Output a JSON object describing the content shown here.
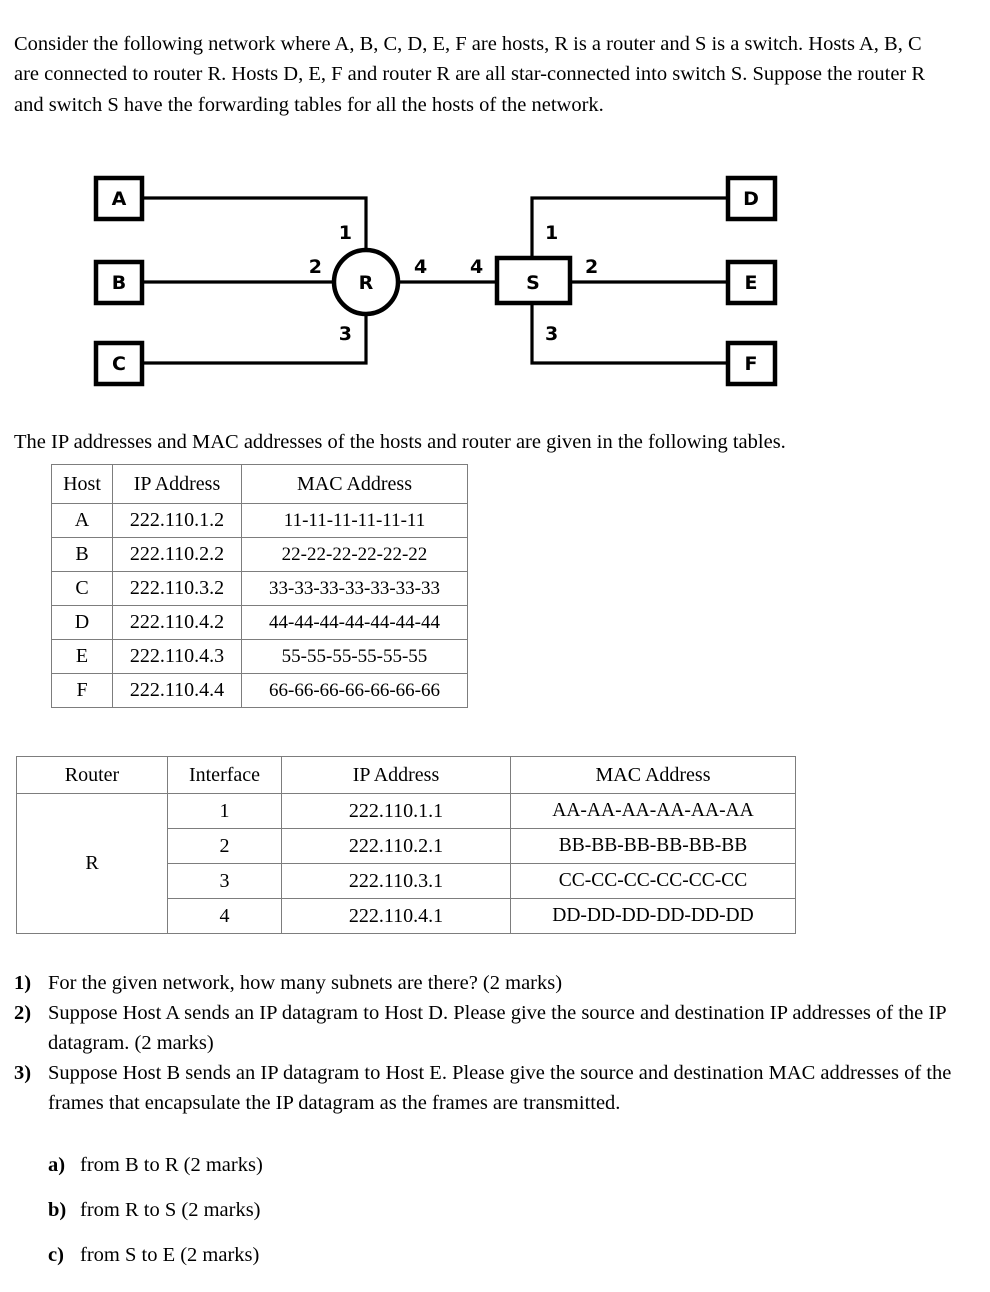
{
  "intro": {
    "paragraph": "Consider the following network where A, B, C, D, E, F are hosts, R is a router and S is a switch. Hosts A, B, C are connected to router R. Hosts D, E, F and router R are all star-connected into switch S. Suppose the router R and switch S have the forwarding tables for all the hosts of the network."
  },
  "diagram": {
    "hosts_left": [
      "A",
      "B",
      "C"
    ],
    "hosts_right": [
      "D",
      "E",
      "F"
    ],
    "router": "R",
    "switch": "S",
    "router_ports": {
      "to_A": "1",
      "to_B": "2",
      "to_C": "3",
      "to_S": "4"
    },
    "switch_ports": {
      "to_R": "4",
      "to_D": "1",
      "to_E": "2",
      "to_F": "3"
    }
  },
  "mid_sentence": "The IP addresses and MAC addresses of the hosts and router are given in the following tables.",
  "host_table": {
    "headers": [
      "Host",
      "IP Address",
      "MAC Address"
    ],
    "rows": [
      [
        "A",
        "222.110.1.2",
        "11-11-11-11-11-11"
      ],
      [
        "B",
        "222.110.2.2",
        "22-22-22-22-22-22"
      ],
      [
        "C",
        "222.110.3.2",
        "33-33-33-33-33-33-33"
      ],
      [
        "D",
        "222.110.4.2",
        "44-44-44-44-44-44-44"
      ],
      [
        "E",
        "222.110.4.3",
        "55-55-55-55-55-55"
      ],
      [
        "F",
        "222.110.4.4",
        "66-66-66-66-66-66-66"
      ]
    ]
  },
  "router_table": {
    "headers": [
      "Router",
      "Interface",
      "IP Address",
      "MAC Address"
    ],
    "router_name": "R",
    "rows": [
      [
        "1",
        "222.110.1.1",
        "AA-AA-AA-AA-AA-AA"
      ],
      [
        "2",
        "222.110.2.1",
        "BB-BB-BB-BB-BB-BB"
      ],
      [
        "3",
        "222.110.3.1",
        "CC-CC-CC-CC-CC-CC"
      ],
      [
        "4",
        "222.110.4.1",
        "DD-DD-DD-DD-DD-DD"
      ]
    ]
  },
  "questions": [
    {
      "num": "1)",
      "text": "For the given network, how many subnets are there? (2 marks)"
    },
    {
      "num": "2)",
      "text": "Suppose Host A sends an IP datagram to Host D. Please give the source and destination IP addresses of the IP datagram. (2 marks)"
    },
    {
      "num": "3)",
      "text": "Suppose Host B sends an IP datagram to Host E. Please give the source and destination MAC addresses of the frames that encapsulate the IP datagram as the frames are transmitted."
    }
  ],
  "subquestions": [
    {
      "num": "a)",
      "text": "from B to R (2 marks)"
    },
    {
      "num": "b)",
      "text": "from R to S (2 marks)"
    },
    {
      "num": "c)",
      "text": "from S to E (2 marks)"
    }
  ]
}
